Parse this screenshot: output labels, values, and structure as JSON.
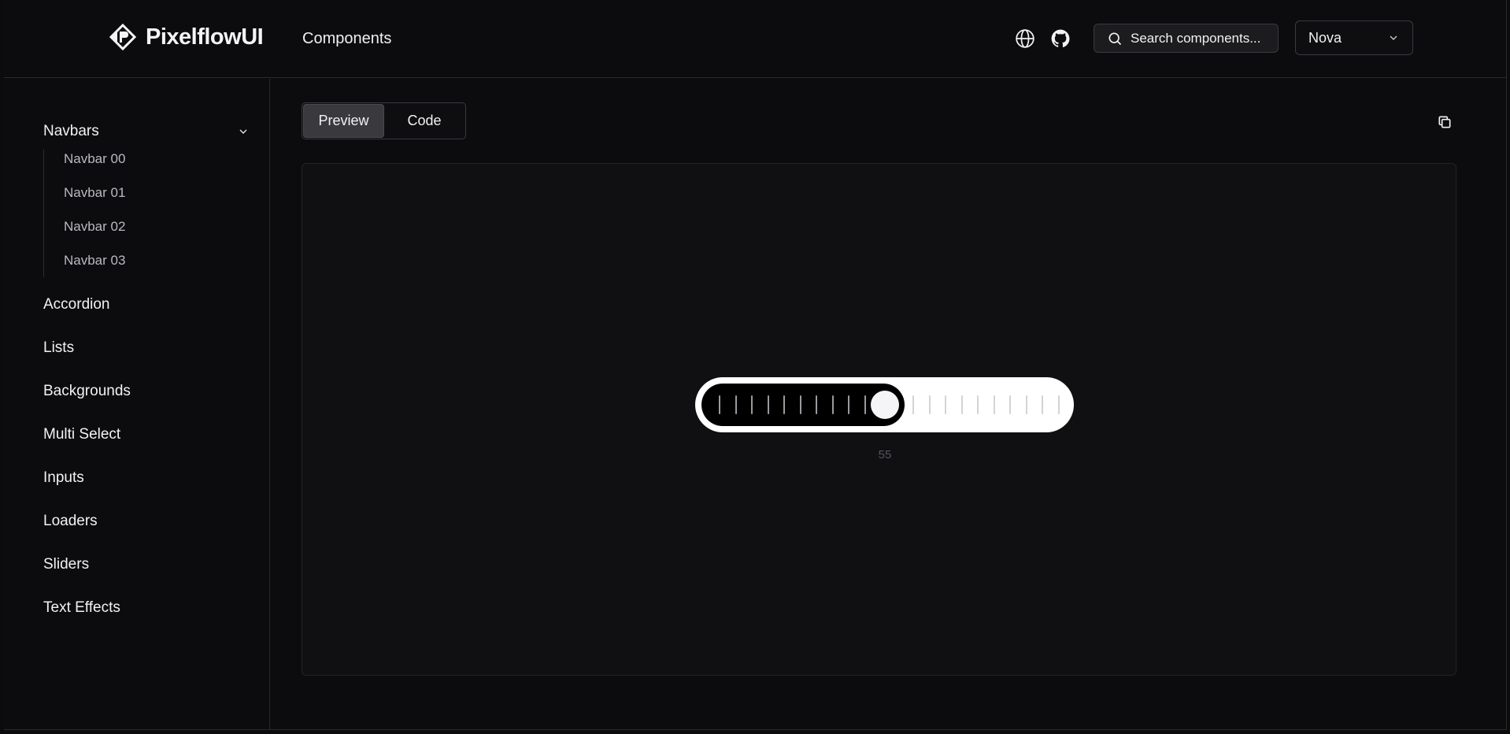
{
  "brand": {
    "name": "PixelflowUI",
    "logo_icon": "pixelflow-logo-icon"
  },
  "header": {
    "nav_link": "Components",
    "language_icon": "globe-icon",
    "github_icon": "github-icon",
    "search": {
      "label": "Search components...",
      "icon": "search-icon"
    },
    "theme_select": {
      "value": "Nova",
      "icon": "chevron-down-icon"
    }
  },
  "sidebar": {
    "group": {
      "label": "Navbars",
      "expanded": true,
      "items": [
        "Navbar 00",
        "Navbar 01",
        "Navbar 02",
        "Navbar 03"
      ]
    },
    "items": [
      "Accordion",
      "Lists",
      "Backgrounds",
      "Multi Select",
      "Inputs",
      "Loaders",
      "Sliders",
      "Text Effects"
    ]
  },
  "main": {
    "tabs": [
      {
        "label": "Preview",
        "active": true
      },
      {
        "label": "Code",
        "active": false
      }
    ],
    "copy_icon": "copy-icon",
    "slider": {
      "value": 55,
      "value_label": "55",
      "min": 0,
      "max": 100
    }
  },
  "colors": {
    "background": "#0c0c0e",
    "accent": "#ffffff",
    "border": "#2a2a2e"
  }
}
